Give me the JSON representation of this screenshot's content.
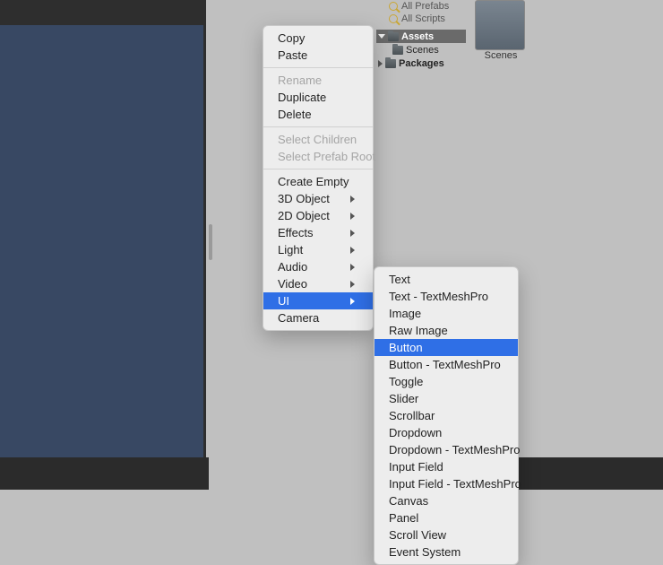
{
  "filters": {
    "prefabs": "All Prefabs",
    "scripts": "All Scripts"
  },
  "tree": {
    "assets": "Assets",
    "scenes": "Scenes",
    "packages": "Packages"
  },
  "thumb": {
    "scenes": "Scenes"
  },
  "menu": {
    "copy": "Copy",
    "paste": "Paste",
    "rename": "Rename",
    "duplicate": "Duplicate",
    "delete": "Delete",
    "select_children": "Select Children",
    "select_prefab_root": "Select Prefab Root",
    "create_empty": "Create Empty",
    "three_d": "3D Object",
    "two_d": "2D Object",
    "effects": "Effects",
    "light": "Light",
    "audio": "Audio",
    "video": "Video",
    "ui": "UI",
    "camera": "Camera"
  },
  "submenu": {
    "text": "Text",
    "text_tmp": "Text - TextMeshPro",
    "image": "Image",
    "raw_image": "Raw Image",
    "button": "Button",
    "button_tmp": "Button - TextMeshPro",
    "toggle": "Toggle",
    "slider": "Slider",
    "scrollbar": "Scrollbar",
    "dropdown": "Dropdown",
    "dropdown_tmp": "Dropdown - TextMeshPro",
    "input": "Input Field",
    "input_tmp": "Input Field - TextMeshPro",
    "canvas": "Canvas",
    "panel": "Panel",
    "scroll_view": "Scroll View",
    "event_system": "Event System"
  }
}
